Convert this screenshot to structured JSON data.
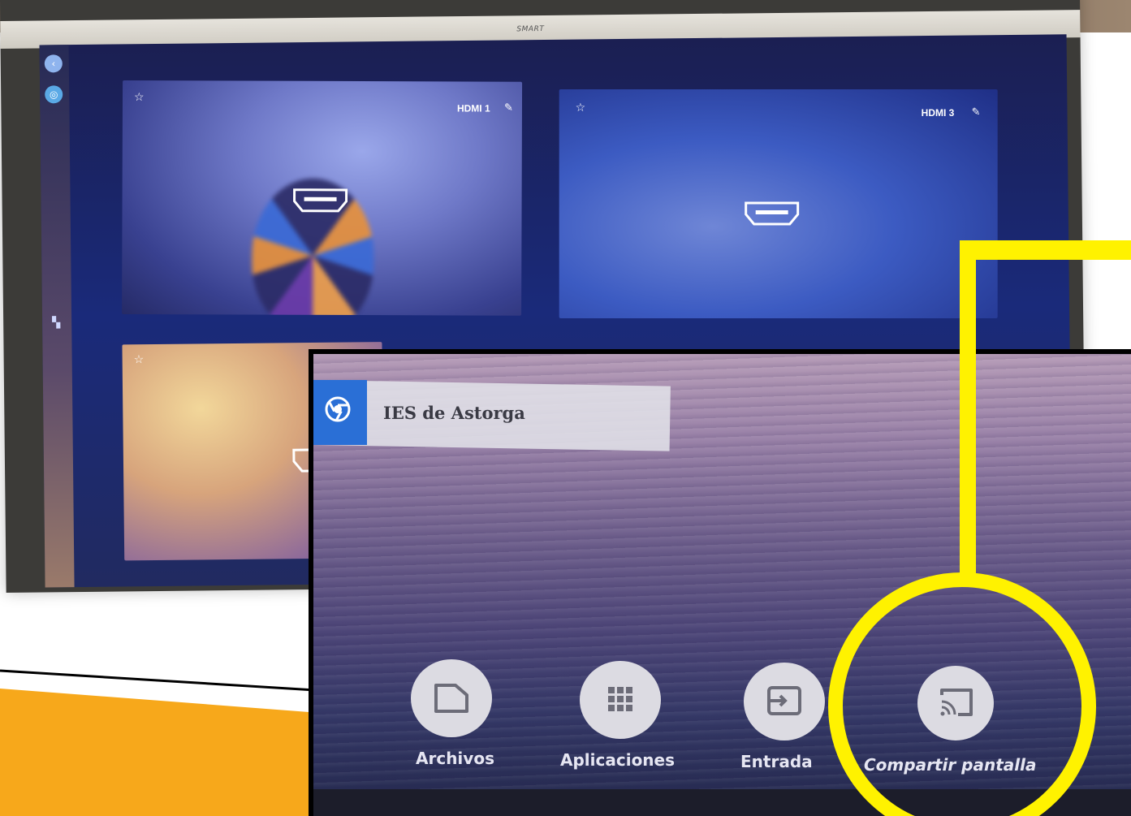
{
  "monitor": {
    "brand": "SMART",
    "tiles": [
      {
        "label": "HDMI 1"
      },
      {
        "label": "HDMI 3"
      }
    ]
  },
  "inset": {
    "window": {
      "title": "IES de Astorga",
      "icon": "chrome-icon"
    },
    "dock": [
      {
        "label": "Archivos",
        "icon": "folder-icon"
      },
      {
        "label": "Aplicaciones",
        "icon": "apps-grid-icon"
      },
      {
        "label": "Entrada",
        "icon": "input-icon"
      },
      {
        "label": "Compartir pantalla",
        "icon": "cast-icon"
      }
    ]
  },
  "colors": {
    "callout": "#fff200",
    "accent_orange": "#f7a81b",
    "chrome_blue": "#2a6fd6"
  }
}
